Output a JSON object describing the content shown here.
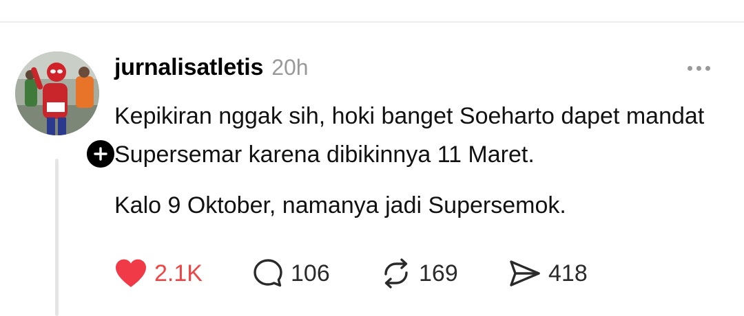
{
  "post": {
    "author": {
      "username": "jurnalisatletis",
      "avatar_icon": "avatar-photo"
    },
    "timestamp": "20h",
    "follow_icon": "plus-icon",
    "more_icon": "more-horizontal-icon",
    "paragraphs": [
      "Kepikiran nggak sih, hoki banget Soeharto dapet mandat Supersemar karena dibikinnya 11 Maret.",
      "Kalo 9 Oktober, namanya jadi Supersemok."
    ],
    "actions": {
      "likes": {
        "count": "2.1K",
        "icon": "heart-icon",
        "liked": true,
        "color": "#f03a47"
      },
      "replies": {
        "count": "106",
        "icon": "comment-icon"
      },
      "reposts": {
        "count": "169",
        "icon": "repost-icon"
      },
      "shares": {
        "count": "418",
        "icon": "send-icon"
      }
    }
  }
}
